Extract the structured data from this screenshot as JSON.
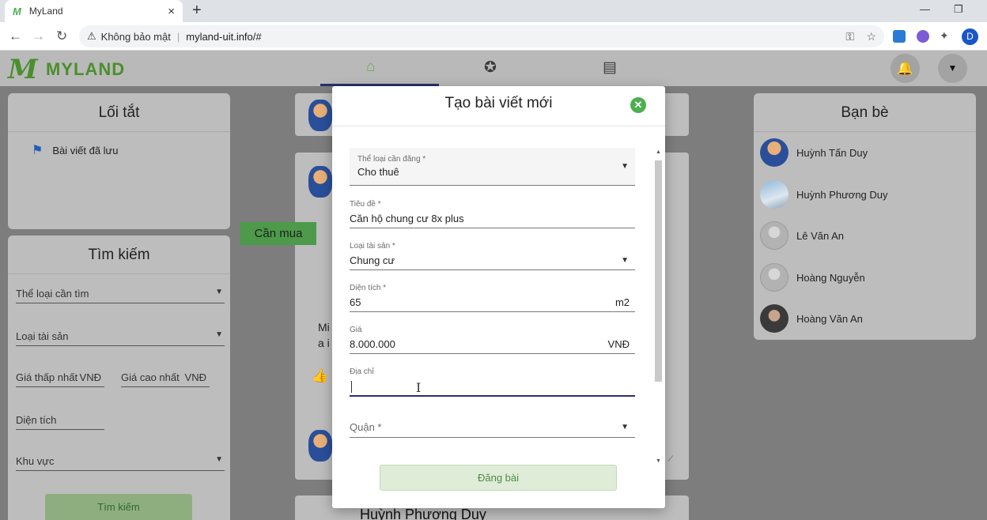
{
  "browser": {
    "tab_title": "MyLand",
    "tab_close": "×",
    "new_tab": "+",
    "security_label": "Không bảo mật",
    "url": "myland-uit.info/#",
    "profile_initial": "D"
  },
  "app": {
    "logo_mark": "M",
    "logo_text": "MYLAND"
  },
  "shortcuts": {
    "title": "Lối tắt",
    "saved_posts": "Bài viết đã lưu"
  },
  "search": {
    "title": "Tìm kiếm",
    "category": "Thể loại cần tìm",
    "property_type": "Loại tài sản",
    "min_price": "Giá thấp nhất",
    "min_price_unit": "VNĐ",
    "max_price": "Giá cao nhất",
    "max_price_unit": "VNĐ",
    "area": "Diện tích",
    "region": "Khu vực",
    "button": "Tìm kiếm"
  },
  "friends": {
    "title": "Bạn bè",
    "items": [
      {
        "name": "Huỳnh Tấn Duy"
      },
      {
        "name": "Huỳnh Phương Duy"
      },
      {
        "name": "Lê Văn An"
      },
      {
        "name": "Hoàng Nguyễn"
      },
      {
        "name": "Hoàng Văn An"
      }
    ]
  },
  "feed": {
    "tag": "Cần mua",
    "text_line1": "Mi",
    "text_line2": "a i",
    "bottom_author": "Huỳnh Phương Duy"
  },
  "modal": {
    "title": "Tạo bài viết mới",
    "fields": {
      "post_type": {
        "label": "Thể loại cần đăng *",
        "value": "Cho thuê"
      },
      "title": {
        "label": "Tiêu đề *",
        "value": "Căn hộ chung cư 8x plus"
      },
      "property_type": {
        "label": "Loại tài sản *",
        "value": "Chung cư"
      },
      "area": {
        "label": "Diện tích *",
        "value": "65",
        "unit": "m2"
      },
      "price": {
        "label": "Giá",
        "value": "8.000.000",
        "unit": "VNĐ"
      },
      "address": {
        "label": "Địa chỉ",
        "value": ""
      },
      "district": {
        "label": "Quận *",
        "value": ""
      }
    },
    "submit": "Đăng bài"
  }
}
